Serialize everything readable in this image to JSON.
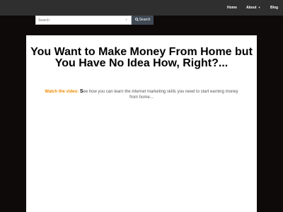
{
  "nav": {
    "home": "Home",
    "about": "About",
    "blog": "Blog"
  },
  "search": {
    "placeholder": "Search",
    "button_label": "Search"
  },
  "main": {
    "headline": "You Want to Make Money From Home but You Have No Idea How, Right?...",
    "video_label": "Watch the video:",
    "intro_first_letter": "S",
    "intro_rest": "ee how you can learn the internet marketing skills you need to start earning money from home..."
  },
  "colors": {
    "nav_bg": "#302f2f",
    "page_bg": "#0f0a0a",
    "content_bg": "#ffffff",
    "accent": "#f08a00",
    "search_button_bg": "#3f4a55"
  }
}
